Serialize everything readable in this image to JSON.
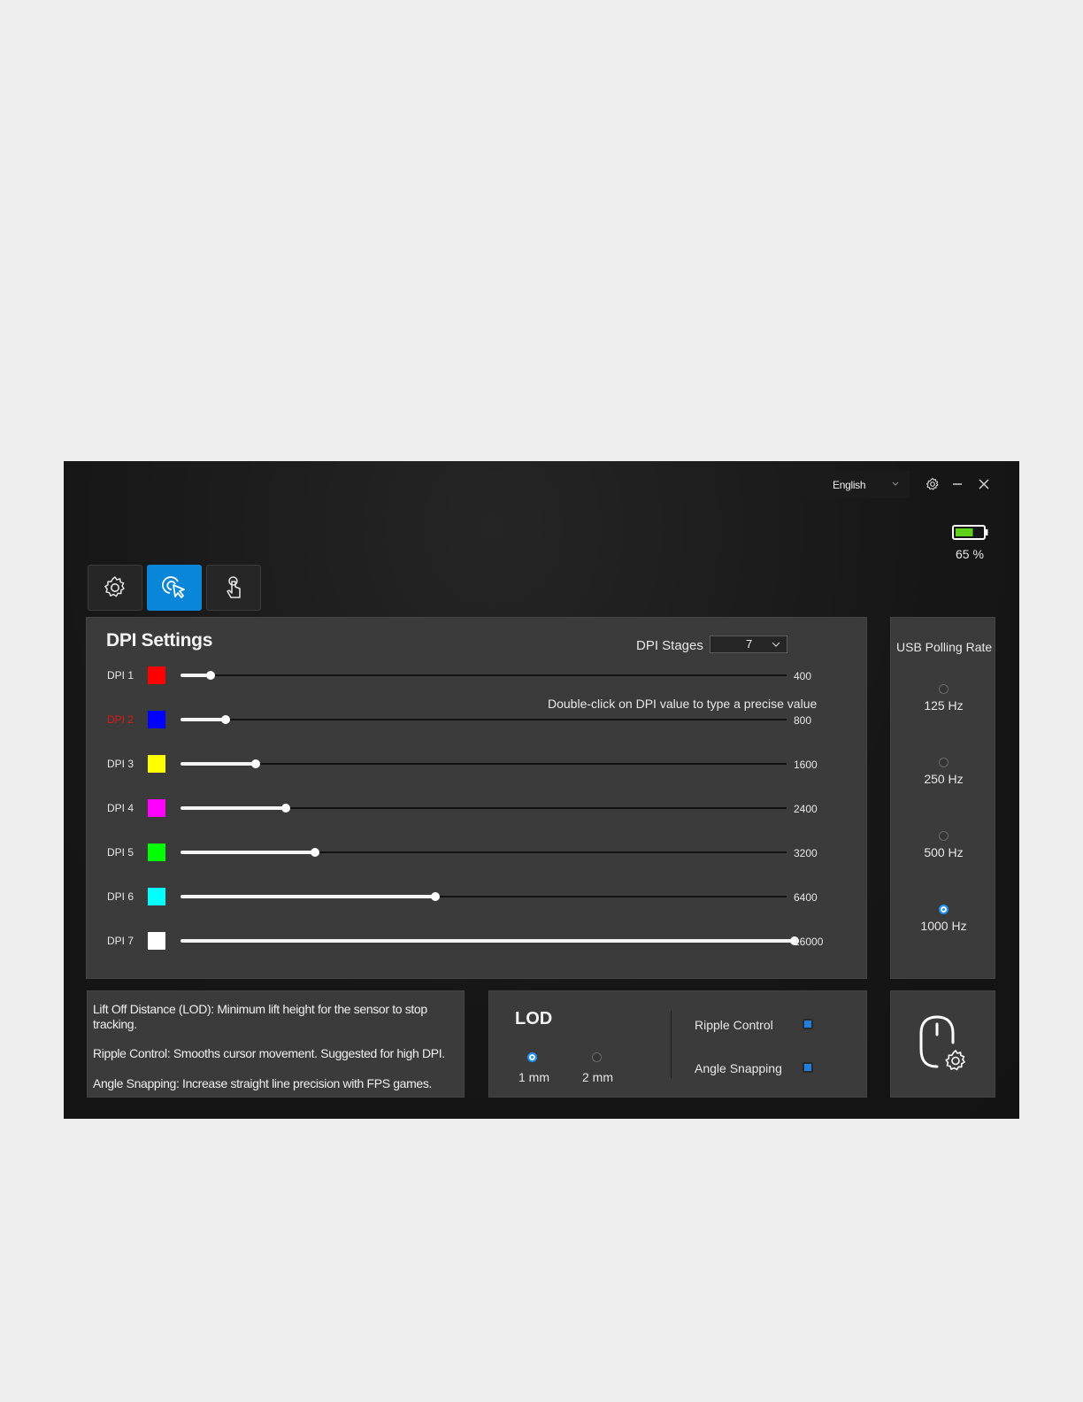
{
  "header": {
    "language": "English",
    "icons": [
      "chevron-down-icon",
      "settings-gear-icon",
      "minimize-icon",
      "close-icon"
    ]
  },
  "battery": {
    "level_percent": 65,
    "text": "65 %",
    "fill_color": "#5fd01a"
  },
  "tabs": [
    {
      "icon": "gear-icon",
      "active": false
    },
    {
      "icon": "mouse-pointer-click-icon",
      "active": true
    },
    {
      "icon": "touch-hand-icon",
      "active": false
    }
  ],
  "dpi_settings": {
    "title": "DPI Settings",
    "stages_label": "DPI Stages",
    "stages_value": "7",
    "hint": "Double-click on DPI value to type a precise value",
    "slider_max": 16000,
    "rows": [
      {
        "label": "DPI 1",
        "color": "#ff0000",
        "value": "400",
        "dpi": 400,
        "selected": false
      },
      {
        "label": "DPI 2",
        "color": "#0000ff",
        "value": "800",
        "dpi": 800,
        "selected": true
      },
      {
        "label": "DPI 3",
        "color": "#ffff00",
        "value": "1600",
        "dpi": 1600,
        "selected": false
      },
      {
        "label": "DPI 4",
        "color": "#ff00ff",
        "value": "2400",
        "dpi": 2400,
        "selected": false
      },
      {
        "label": "DPI 5",
        "color": "#00ff00",
        "value": "3200",
        "dpi": 3200,
        "selected": false
      },
      {
        "label": "DPI 6",
        "color": "#00ffff",
        "value": "6400",
        "dpi": 6400,
        "selected": false
      },
      {
        "label": "DPI 7",
        "color": "#ffffff",
        "value": "16000",
        "dpi": 16000,
        "selected": false
      }
    ]
  },
  "polling": {
    "title": "USB Polling Rate",
    "options": [
      {
        "label": "125 Hz",
        "selected": false
      },
      {
        "label": "250 Hz",
        "selected": false
      },
      {
        "label": "500 Hz",
        "selected": false
      },
      {
        "label": "1000 Hz",
        "selected": true
      }
    ]
  },
  "info": {
    "lod": "Lift Off Distance (LOD): Minimum lift height for the sensor to stop tracking.",
    "ripple": "Ripple Control: Smooths cursor movement. Suggested for high DPI.",
    "angle": "Angle Snapping: Increase straight line precision with FPS games."
  },
  "lod": {
    "title": "LOD",
    "options": [
      {
        "label": "1 mm",
        "selected": true
      },
      {
        "label": "2 mm",
        "selected": false
      }
    ],
    "toggles": [
      {
        "label": "Ripple Control",
        "on": true
      },
      {
        "label": "Angle Snapping",
        "on": true
      }
    ]
  },
  "mouse_settings": {
    "icon": "mouse-settings-icon"
  },
  "colors": {
    "accent": "#0a86d8",
    "panel": "#3b3b3b",
    "background": "#161616"
  }
}
